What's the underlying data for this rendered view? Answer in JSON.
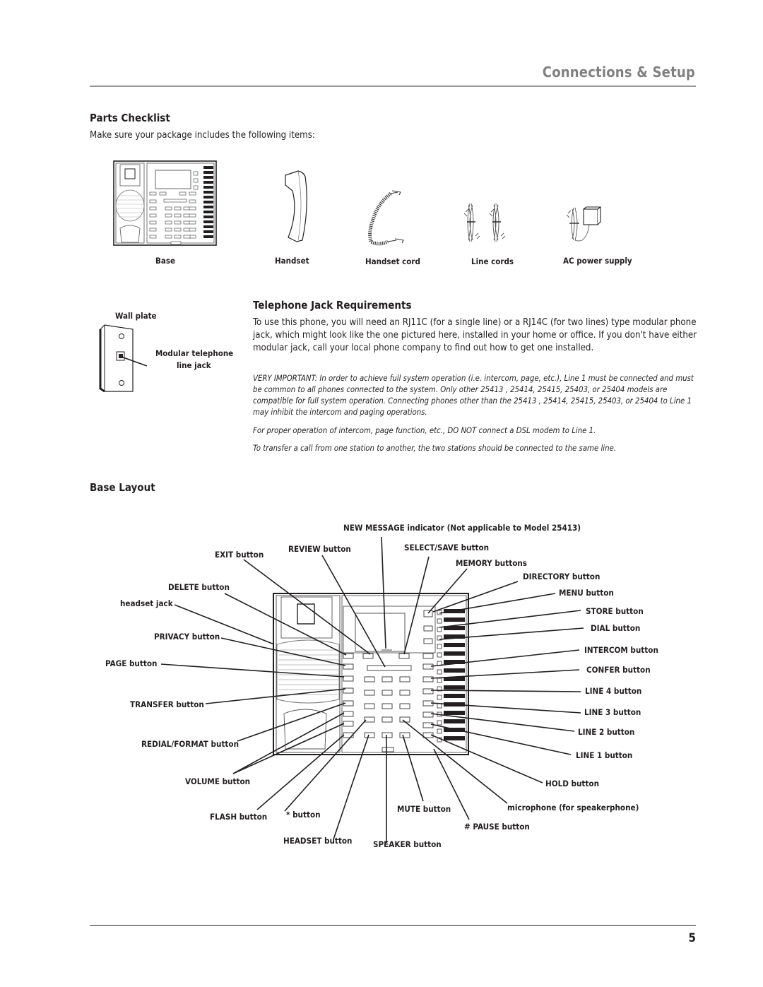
{
  "header": {
    "section_title": "Connections & Setup"
  },
  "parts_checklist": {
    "heading": "Parts Checklist",
    "intro": "Make sure your package includes the following items:",
    "items": [
      {
        "label": "Base",
        "icon": "phone-base-illustration"
      },
      {
        "label": "Handset",
        "icon": "handset-illustration"
      },
      {
        "label": "Handset cord",
        "icon": "coiled-cord-illustration"
      },
      {
        "label": "Line cords",
        "icon": "line-cords-illustration"
      },
      {
        "label": "AC power supply",
        "icon": "power-adapter-illustration"
      }
    ]
  },
  "wall_plate": {
    "title": "Wall plate",
    "jack_label_1": "Modular telephone",
    "jack_label_2": "line jack"
  },
  "jack_requirements": {
    "heading": "Telephone Jack Requirements",
    "paragraph": "To use this phone, you will need an RJ11C (for a single line) or a RJ14C (for two lines) type modular phone jack, which might look like the one pictured here, installed in your home or office. If you don't have either modular jack, call your local phone company to find out how to get one installed.",
    "notes": [
      "VERY IMPORTANT: In order to achieve full system operation (i.e. intercom, page, etc.), Line 1 must be connected and must be common to all phones connected to the system. Only other 25413 , 25414, 25415, 25403, or 25404 models are compatible for full system operation. Connecting phones other than the 25413 , 25414, 25415, 25403, or 25404 to Line 1 may inhibit the intercom and paging operations.",
      "For proper operation of intercom, page function, etc., DO NOT connect a DSL modem to Line 1.",
      "To transfer a call from one station to another, the two stations should be connected to the same line."
    ]
  },
  "base_layout": {
    "heading": "Base Layout",
    "callouts": {
      "new_message": "NEW MESSAGE indicator (Not applicable to Model 25413)",
      "exit": "EXIT button",
      "review": "REVIEW button",
      "select_save": "SELECT/SAVE button",
      "memory": "MEMORY buttons",
      "directory": "DIRECTORY button",
      "delete": "DELETE button",
      "menu": "MENU button",
      "headset_jack": "headset jack",
      "store": "STORE button",
      "dial": "DIAL button",
      "privacy": "PRIVACY button",
      "intercom": "INTERCOM button",
      "page": "PAGE button",
      "confer": "CONFER button",
      "line4": "LINE 4 button",
      "transfer": "TRANSFER button",
      "line3": "LINE 3 button",
      "line2": "LINE 2 button",
      "redial": "REDIAL/FORMAT button",
      "line1": "LINE 1 button",
      "volume": "VOLUME button",
      "hold": "HOLD button",
      "flash": "FLASH button",
      "star": "* button",
      "mute": "MUTE button",
      "microphone": "microphone (for speakerphone)",
      "pause": "# PAUSE button",
      "headset": "HEADSET button",
      "speaker": "SPEAKER button"
    }
  },
  "footer": {
    "page_number": "5"
  }
}
